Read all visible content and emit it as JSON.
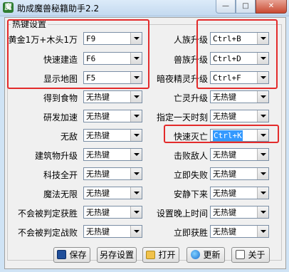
{
  "window": {
    "title": "助成魔兽秘籍助手2.2",
    "min": "—",
    "max": "□",
    "close": "✕"
  },
  "group": {
    "title": "热键设置"
  },
  "left_rows": [
    {
      "label": "黄金1万+木头1万",
      "value": "F9"
    },
    {
      "label": "快速建造",
      "value": "F6"
    },
    {
      "label": "显示地图",
      "value": "F5"
    },
    {
      "label": "得到食物",
      "value": "无热键"
    },
    {
      "label": "研发加速",
      "value": "无热键"
    },
    {
      "label": "无敌",
      "value": "无热键"
    },
    {
      "label": "建筑物升级",
      "value": "无热键"
    },
    {
      "label": "科技全开",
      "value": "无热键"
    },
    {
      "label": "魔法无限",
      "value": "无热键"
    },
    {
      "label": "不会被判定获胜",
      "value": "无热键"
    },
    {
      "label": "不会被判定战败",
      "value": "无热键"
    }
  ],
  "right_rows": [
    {
      "label": "人族升级",
      "value": "Ctrl+B"
    },
    {
      "label": "兽族升级",
      "value": "Ctrl+D"
    },
    {
      "label": "暗夜精灵升级",
      "value": "Ctrl+F"
    },
    {
      "label": "亡灵升级",
      "value": "无热键"
    },
    {
      "label": "指定一天时刻",
      "value": "无热键"
    },
    {
      "label": "快速灭亡",
      "value": "Ctrl+K"
    },
    {
      "label": "击败敌人",
      "value": "无热键"
    },
    {
      "label": "立即失败",
      "value": "无热键"
    },
    {
      "label": "安静下来",
      "value": "无热键"
    },
    {
      "label": "设置晚上时间",
      "value": "无热键"
    },
    {
      "label": "立即获胜",
      "value": "无热键"
    }
  ],
  "buttons": {
    "save": "保存",
    "save_as": "另存设置",
    "open": "打开",
    "update": "更新",
    "about": "关于"
  },
  "colors": {
    "highlight": "#e32b2b",
    "selection": "#3399ff"
  }
}
